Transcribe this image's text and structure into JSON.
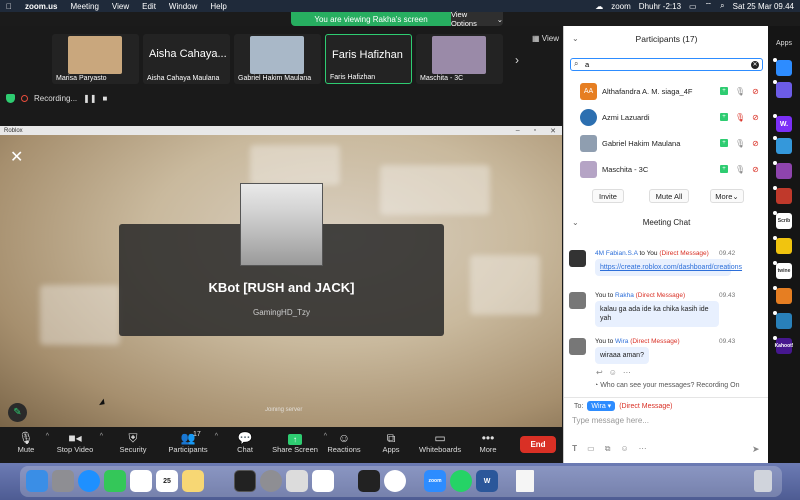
{
  "menubar": {
    "app": "zoom.us",
    "items": [
      "Meeting",
      "View",
      "Edit",
      "Window",
      "Help"
    ],
    "prayer": "Dhuhr -2:13",
    "datetime": "Sat 25 Mar  09.44",
    "zoom_label": "zoom"
  },
  "banner": {
    "viewing": "You are viewing Rakha's screen",
    "view_options": "View Options"
  },
  "gallery": {
    "tiles": [
      {
        "name": "Marisa Paryasto",
        "photo_color": "#c9a77d"
      },
      {
        "name": "Aisha Cahaya Maulana",
        "big": "Aisha Cahaya..."
      },
      {
        "name": "Gabriel Hakim Maulana",
        "photo_color": "#a9b8c8"
      },
      {
        "name": "Faris Hafizhan",
        "big": "Faris Hafizhan"
      },
      {
        "name": "Maschita - 3C",
        "photo_color": "#9a8aa8"
      }
    ],
    "view_label": "View",
    "recording": "Recording..."
  },
  "shared": {
    "window_title": "Roblox",
    "game_title": "KBot [RUSH and JACK]",
    "author": "GamingHD_Tzy",
    "status": "Joining server"
  },
  "toolbar": {
    "mute": "Mute",
    "stop_video": "Stop Video",
    "security": "Security",
    "participants": "Participants",
    "participants_count": "17",
    "chat": "Chat",
    "share_screen": "Share Screen",
    "reactions": "Reactions",
    "apps": "Apps",
    "whiteboards": "Whiteboards",
    "more": "More",
    "end": "End"
  },
  "participants_panel": {
    "title": "Participants (17)",
    "search_value": "a",
    "people": [
      {
        "name": "Althafandra A. M. siaga_4F",
        "initials": "AA",
        "color": "#e67e22"
      },
      {
        "name": "Azmi Lazuardi",
        "initials": "",
        "color": "#2c6fb0"
      },
      {
        "name": "Gabriel Hakim Maulana",
        "initials": "",
        "color": "#8f9eb0"
      },
      {
        "name": "Maschita - 3C",
        "initials": "",
        "color": "#b5a4c5"
      }
    ],
    "invite": "Invite",
    "mute_all": "Mute All",
    "more": "More"
  },
  "chat": {
    "title": "Meeting Chat",
    "messages": [
      {
        "from": "4M Fabian.S.A",
        "to": "to You",
        "dm": "(Direct Message)",
        "time": "09.42",
        "text": "https://create.roblox.com/dashboard/creations"
      },
      {
        "from": "You",
        "to": "Rakha",
        "dm": "(Direct Message)",
        "time": "09.43",
        "text": "kalau ga ada ide ka chika kasih ide yah"
      },
      {
        "from": "You",
        "to": "Wira",
        "dm": "(Direct Message)",
        "time": "09.43",
        "text": "wiraaa aman?"
      }
    ],
    "privacy": "Who can see your messages? Recording On",
    "to_label": "To:",
    "recipient": "Wira",
    "recipient_dm": "(Direct Message)",
    "placeholder": "Type message here..."
  },
  "apps_sidebar": {
    "title": "Apps",
    "items": [
      {
        "label": "",
        "color": "#2d8cff"
      },
      {
        "label": "",
        "color": "#6c5ce7"
      },
      {
        "label": "W.",
        "color": "#7b2ff7"
      },
      {
        "label": "",
        "color": "#3498db"
      },
      {
        "label": "",
        "color": "#8e44ad"
      },
      {
        "label": "",
        "color": "#c0392b"
      },
      {
        "label": "Scrib",
        "color": "#ffffff"
      },
      {
        "label": "",
        "color": "#f1c40f"
      },
      {
        "label": "twine",
        "color": "#ffffff"
      },
      {
        "label": "",
        "color": "#e67e22"
      },
      {
        "label": "",
        "color": "#2980b9"
      },
      {
        "label": "Kahoot!",
        "color": "#46178f"
      }
    ]
  },
  "dock": {
    "items": [
      {
        "name": "finder",
        "color": "#3a8ee6",
        "label": ""
      },
      {
        "name": "launchpad",
        "color": "#8e8e93",
        "label": ""
      },
      {
        "name": "safari",
        "color": "#1e90ff",
        "label": ""
      },
      {
        "name": "messages",
        "color": "#34c759",
        "label": ""
      },
      {
        "name": "photos",
        "color": "#ffffff",
        "label": ""
      },
      {
        "name": "calendar",
        "color": "#ffffff",
        "label": "25"
      },
      {
        "name": "notes",
        "color": "#f7d774",
        "label": ""
      },
      {
        "name": "terminal",
        "color": "#222222",
        "label": ""
      },
      {
        "name": "system-settings",
        "color": "#8e8e93",
        "label": ""
      },
      {
        "name": "preview",
        "color": "#dcdcdc",
        "label": ""
      },
      {
        "name": "roblox-studio",
        "color": "#ffffff",
        "label": ""
      },
      {
        "name": "activity",
        "color": "#222222",
        "label": ""
      },
      {
        "name": "chrome",
        "color": "#ffffff",
        "label": ""
      },
      {
        "name": "zoom",
        "color": "#2d8cff",
        "label": "zoom"
      },
      {
        "name": "whatsapp",
        "color": "#25d366",
        "label": ""
      },
      {
        "name": "word",
        "color": "#2b579a",
        "label": "W"
      },
      {
        "name": "document",
        "color": "#f5f5f5",
        "label": ""
      },
      {
        "name": "trash",
        "color": "#d0d4dc",
        "label": ""
      }
    ]
  }
}
